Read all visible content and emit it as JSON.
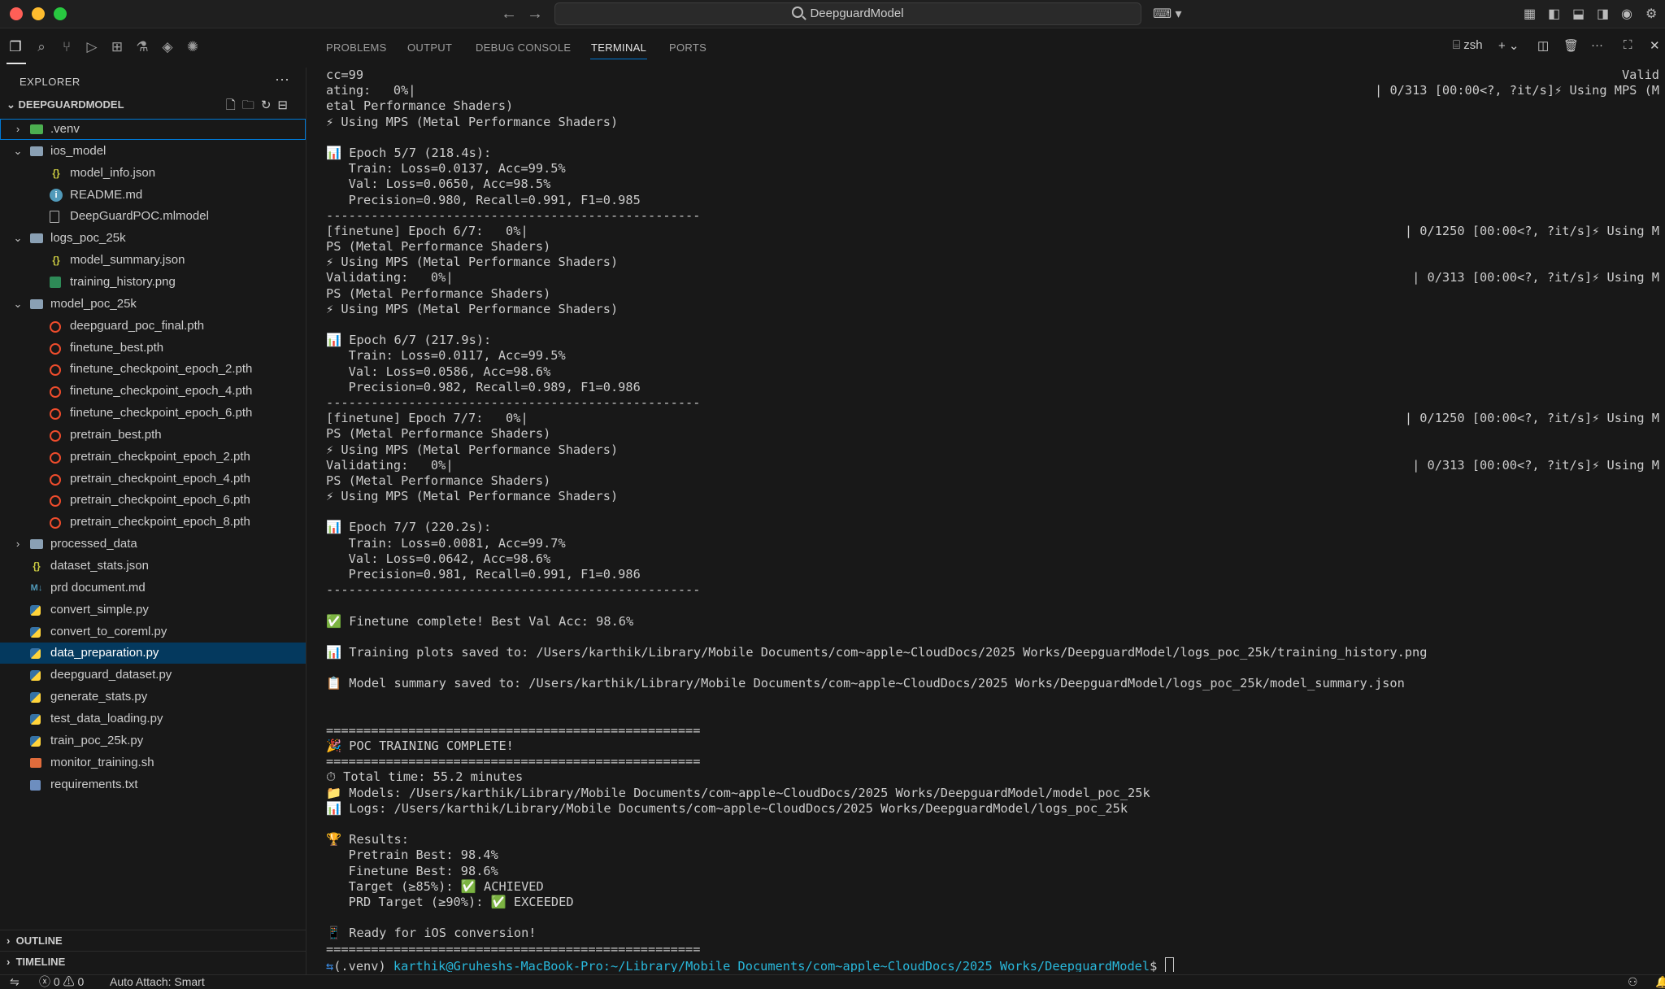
{
  "window": {
    "search_title": "DeepguardModel"
  },
  "sidebar": {
    "title": "EXPLORER",
    "more": "···",
    "workspace": "DEEPGUARDMODEL",
    "outline": "OUTLINE",
    "timeline": "TIMELINE",
    "tree": [
      {
        "label": ".venv",
        "type": "folder-venv",
        "level": 0,
        "expanded": false,
        "focused": true
      },
      {
        "label": "ios_model",
        "type": "folder",
        "level": 0,
        "expanded": true
      },
      {
        "label": "model_info.json",
        "type": "json",
        "level": 1
      },
      {
        "label": "README.md",
        "type": "info",
        "level": 1
      },
      {
        "label": "DeepGuardPOC.mlmodel",
        "type": "doc",
        "level": 1
      },
      {
        "label": "logs_poc_25k",
        "type": "folder",
        "level": 0,
        "expanded": true
      },
      {
        "label": "model_summary.json",
        "type": "json",
        "level": 1
      },
      {
        "label": "training_history.png",
        "type": "image",
        "level": 1
      },
      {
        "label": "model_poc_25k",
        "type": "folder",
        "level": 0,
        "expanded": true
      },
      {
        "label": "deepguard_poc_final.pth",
        "type": "pth",
        "level": 1
      },
      {
        "label": "finetune_best.pth",
        "type": "pth",
        "level": 1
      },
      {
        "label": "finetune_checkpoint_epoch_2.pth",
        "type": "pth",
        "level": 1
      },
      {
        "label": "finetune_checkpoint_epoch_4.pth",
        "type": "pth",
        "level": 1
      },
      {
        "label": "finetune_checkpoint_epoch_6.pth",
        "type": "pth",
        "level": 1
      },
      {
        "label": "pretrain_best.pth",
        "type": "pth",
        "level": 1
      },
      {
        "label": "pretrain_checkpoint_epoch_2.pth",
        "type": "pth",
        "level": 1
      },
      {
        "label": "pretrain_checkpoint_epoch_4.pth",
        "type": "pth",
        "level": 1
      },
      {
        "label": "pretrain_checkpoint_epoch_6.pth",
        "type": "pth",
        "level": 1
      },
      {
        "label": "pretrain_checkpoint_epoch_8.pth",
        "type": "pth",
        "level": 1
      },
      {
        "label": "processed_data",
        "type": "folder",
        "level": 0,
        "expanded": false
      },
      {
        "label": "dataset_stats.json",
        "type": "json",
        "level": 0
      },
      {
        "label": "prd document.md",
        "type": "md",
        "level": 0
      },
      {
        "label": "convert_simple.py",
        "type": "py",
        "level": 0
      },
      {
        "label": "convert_to_coreml.py",
        "type": "py",
        "level": 0
      },
      {
        "label": "data_preparation.py",
        "type": "py",
        "level": 0,
        "selected": true
      },
      {
        "label": "deepguard_dataset.py",
        "type": "py",
        "level": 0
      },
      {
        "label": "generate_stats.py",
        "type": "py",
        "level": 0
      },
      {
        "label": "test_data_loading.py",
        "type": "py",
        "level": 0
      },
      {
        "label": "train_poc_25k.py",
        "type": "py",
        "level": 0
      },
      {
        "label": "monitor_training.sh",
        "type": "sh",
        "level": 0
      },
      {
        "label": "requirements.txt",
        "type": "txt",
        "level": 0
      }
    ]
  },
  "panel": {
    "tabs": [
      "PROBLEMS",
      "OUTPUT",
      "DEBUG CONSOLE",
      "TERMINAL",
      "PORTS"
    ],
    "active_tab": "TERMINAL",
    "shell": "zsh"
  },
  "terminal": {
    "lines": [
      {
        "text": "cc=99",
        "right": "Valid"
      },
      {
        "text": "ating:   0%|",
        "right": "| 0/313 [00:00<?, ?it/s]⚡ Using MPS (M"
      },
      {
        "text": "etal Performance Shaders)"
      },
      {
        "text": "⚡ Using MPS (Metal Performance Shaders)"
      },
      {
        "text": ""
      },
      {
        "text": "📊 Epoch 5/7 (218.4s):"
      },
      {
        "text": "   Train: Loss=0.0137, Acc=99.5%"
      },
      {
        "text": "   Val: Loss=0.0650, Acc=98.5%"
      },
      {
        "text": "   Precision=0.980, Recall=0.991, F1=0.985"
      },
      {
        "text": "--------------------------------------------------"
      },
      {
        "text": "[finetune] Epoch 6/7:   0%|",
        "right": "| 0/1250 [00:00<?, ?it/s]⚡ Using M"
      },
      {
        "text": "PS (Metal Performance Shaders)"
      },
      {
        "text": "⚡ Using MPS (Metal Performance Shaders)"
      },
      {
        "text": "Validating:   0%|",
        "right": "| 0/313 [00:00<?, ?it/s]⚡ Using M"
      },
      {
        "text": "PS (Metal Performance Shaders)"
      },
      {
        "text": "⚡ Using MPS (Metal Performance Shaders)"
      },
      {
        "text": ""
      },
      {
        "text": "📊 Epoch 6/7 (217.9s):"
      },
      {
        "text": "   Train: Loss=0.0117, Acc=99.5%"
      },
      {
        "text": "   Val: Loss=0.0586, Acc=98.6%"
      },
      {
        "text": "   Precision=0.982, Recall=0.989, F1=0.986"
      },
      {
        "text": "--------------------------------------------------"
      },
      {
        "text": "[finetune] Epoch 7/7:   0%|",
        "right": "| 0/1250 [00:00<?, ?it/s]⚡ Using M"
      },
      {
        "text": "PS (Metal Performance Shaders)"
      },
      {
        "text": "⚡ Using MPS (Metal Performance Shaders)"
      },
      {
        "text": "Validating:   0%|",
        "right": "| 0/313 [00:00<?, ?it/s]⚡ Using M"
      },
      {
        "text": "PS (Metal Performance Shaders)"
      },
      {
        "text": "⚡ Using MPS (Metal Performance Shaders)"
      },
      {
        "text": ""
      },
      {
        "text": "📊 Epoch 7/7 (220.2s):"
      },
      {
        "text": "   Train: Loss=0.0081, Acc=99.7%"
      },
      {
        "text": "   Val: Loss=0.0642, Acc=98.6%"
      },
      {
        "text": "   Precision=0.981, Recall=0.991, F1=0.986"
      },
      {
        "text": "--------------------------------------------------"
      },
      {
        "text": ""
      },
      {
        "text": "✅ Finetune complete! Best Val Acc: 98.6%"
      },
      {
        "text": ""
      },
      {
        "text": "📊 Training plots saved to: /Users/karthik/Library/Mobile Documents/com~apple~CloudDocs/2025 Works/DeepguardModel/logs_poc_25k/training_history.png"
      },
      {
        "text": ""
      },
      {
        "text": "📋 Model summary saved to: /Users/karthik/Library/Mobile Documents/com~apple~CloudDocs/2025 Works/DeepguardModel/logs_poc_25k/model_summary.json"
      },
      {
        "text": ""
      },
      {
        "text": ""
      },
      {
        "text": "=================================================="
      },
      {
        "text": "🎉 POC TRAINING COMPLETE!"
      },
      {
        "text": "=================================================="
      },
      {
        "text": "⏱ Total time: 55.2 minutes"
      },
      {
        "text": "📁 Models: /Users/karthik/Library/Mobile Documents/com~apple~CloudDocs/2025 Works/DeepguardModel/model_poc_25k"
      },
      {
        "text": "📊 Logs: /Users/karthik/Library/Mobile Documents/com~apple~CloudDocs/2025 Works/DeepguardModel/logs_poc_25k"
      },
      {
        "text": ""
      },
      {
        "text": "🏆 Results:"
      },
      {
        "text": "   Pretrain Best: 98.4%"
      },
      {
        "text": "   Finetune Best: 98.6%"
      },
      {
        "text": "   Target (≥85%): ✅ ACHIEVED"
      },
      {
        "text": "   PRD Target (≥90%): ✅ EXCEEDED"
      },
      {
        "text": ""
      },
      {
        "text": "📱 Ready for iOS conversion!"
      },
      {
        "text": "=================================================="
      }
    ],
    "prompt_env": "(.venv)",
    "prompt_user": "karthik@Gruheshs-MacBook-Pro",
    "prompt_path": ":~/Library/Mobile Documents/com~apple~CloudDocs/2025 Works/DeepguardModel",
    "prompt_symbol": "$"
  },
  "statusbar": {
    "errors": "0",
    "warnings": "0",
    "auto_attach": "Auto Attach: Smart"
  }
}
